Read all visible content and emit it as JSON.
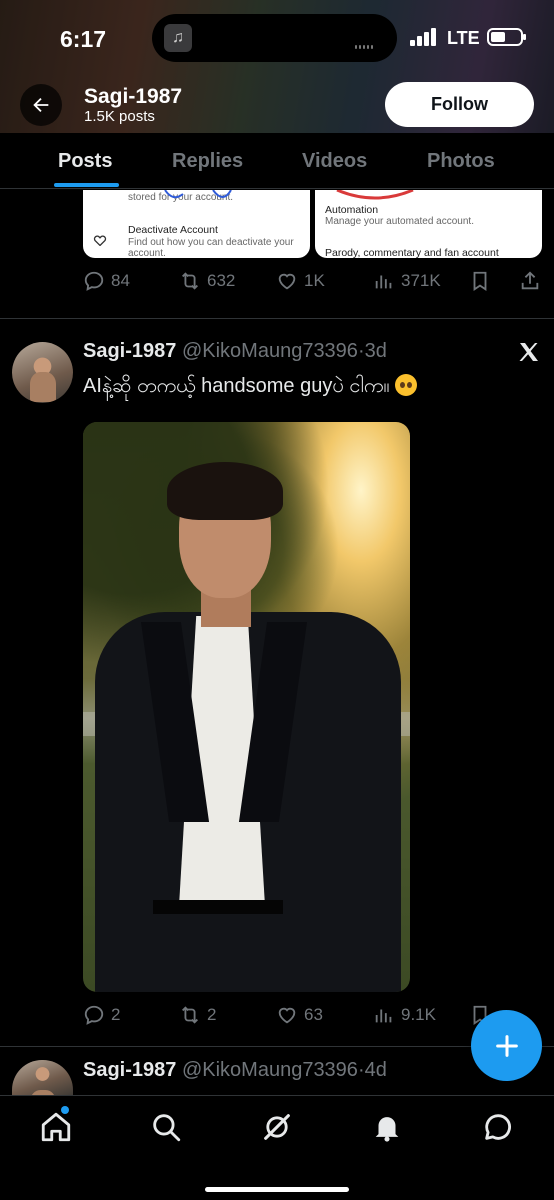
{
  "status_bar": {
    "time": "6:17",
    "network": "LTE"
  },
  "profile": {
    "name": "Sagi-1987",
    "posts_count": "1.5K posts",
    "follow_label": "Follow"
  },
  "tabs": [
    {
      "label": "Posts"
    },
    {
      "label": "Replies"
    },
    {
      "label": "Videos"
    },
    {
      "label": "Photos"
    }
  ],
  "prev_post": {
    "card_left": {
      "line1": "stored for your account.",
      "title": "Deactivate Account",
      "desc1": "Find out how you can deactivate your",
      "desc2": "account."
    },
    "card_right": {
      "title": "Automation",
      "desc": "Manage your automated account.",
      "title2": "Parody, commentary and fan account"
    },
    "stats": {
      "replies": "84",
      "reposts": "632",
      "likes": "1K",
      "views": "371K"
    }
  },
  "post": {
    "name": "Sagi-1987",
    "handle": "@KikoMaung73396",
    "separator": "·",
    "time": "3d",
    "text": "AIနဲ့ဆို တကယ့် handsome guyပဲ ငါက။",
    "emoji": "pleading-face-emoji",
    "stats": {
      "replies": "2",
      "reposts": "2",
      "likes": "63",
      "views": "9.1K"
    }
  },
  "next_post": {
    "name": "Sagi-1987",
    "handle": "@KikoMaung73396",
    "separator": "·",
    "time": "4d"
  },
  "colors": {
    "accent": "#1d9bf0",
    "background": "#000000",
    "muted": "#71767b",
    "text": "#e7e9ea"
  }
}
